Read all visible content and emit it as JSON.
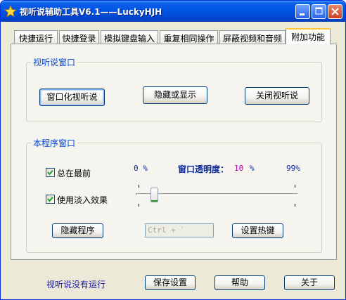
{
  "window": {
    "title": "视听说辅助工具V6.1——LuckyHJH",
    "accent": "#0055E5"
  },
  "tabs": [
    {
      "label": "快捷运行",
      "active": false
    },
    {
      "label": "快捷登录",
      "active": false
    },
    {
      "label": "模拟键盘输入",
      "active": false
    },
    {
      "label": "重复相同操作",
      "active": false
    },
    {
      "label": "屏蔽视频和音频",
      "active": false
    },
    {
      "label": "附加功能",
      "active": true
    }
  ],
  "group_window": {
    "title": "视听说窗口",
    "buttons": {
      "windowed": "窗口化视听说",
      "toggle": "隐藏或显示",
      "close": "关闭视听说"
    }
  },
  "group_program": {
    "title": "本程序窗口",
    "always_on_top": {
      "label": "总在最前",
      "checked": true
    },
    "fade_effect": {
      "label": "使用淡入效果",
      "checked": true
    },
    "opacity": {
      "min_label": "0 %",
      "caption": "窗口透明度：",
      "value_num": "10",
      "value_unit": "%",
      "max_label": "99%",
      "value": 10
    },
    "hide_button": "隐藏程序",
    "hotkey_value": "Ctrl + `",
    "hotkey_button": "设置热键"
  },
  "footer": {
    "status": "视听说没有运行",
    "save": "保存设置",
    "help": "帮助",
    "about": "关于"
  },
  "icons": {
    "app": "star-icon",
    "minimize": "minimize-icon",
    "maximize": "maximize-icon",
    "close": "close-icon"
  }
}
